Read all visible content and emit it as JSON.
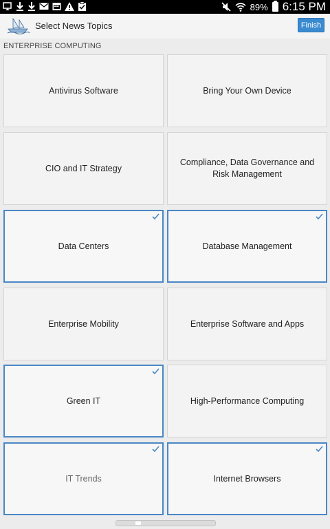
{
  "status_bar": {
    "left_icons": [
      "cast-icon",
      "download-icon",
      "download-icon",
      "mail-icon",
      "calendar-icon",
      "warning-icon",
      "clipboard-icon"
    ],
    "right_icons": [
      "mute-icon",
      "wifi-icon"
    ],
    "battery_percent": "89%",
    "time": "6:15 PM"
  },
  "app_bar": {
    "title": "Select News Topics",
    "finish_label": "Finish",
    "logo_icon": "ship-logo-icon"
  },
  "section": {
    "title": "ENTERPRISE COMPUTING"
  },
  "topics": [
    {
      "label": "Antivirus Software",
      "selected": false
    },
    {
      "label": "Bring Your Own Device",
      "selected": false
    },
    {
      "label": "CIO and IT Strategy",
      "selected": false
    },
    {
      "label": "Compliance, Data Governance and Risk Management",
      "selected": false
    },
    {
      "label": "Data Centers",
      "selected": true
    },
    {
      "label": "Database Management",
      "selected": true
    },
    {
      "label": "Enterprise Mobility",
      "selected": false
    },
    {
      "label": "Enterprise Software and Apps",
      "selected": false
    },
    {
      "label": "Green IT",
      "selected": true
    },
    {
      "label": "High-Performance Computing",
      "selected": false
    },
    {
      "label": "IT Trends",
      "selected": true
    },
    {
      "label": "Internet Browsers",
      "selected": true
    }
  ],
  "colors": {
    "accent": "#3a8ad0",
    "selected_border": "#4a87c6"
  }
}
